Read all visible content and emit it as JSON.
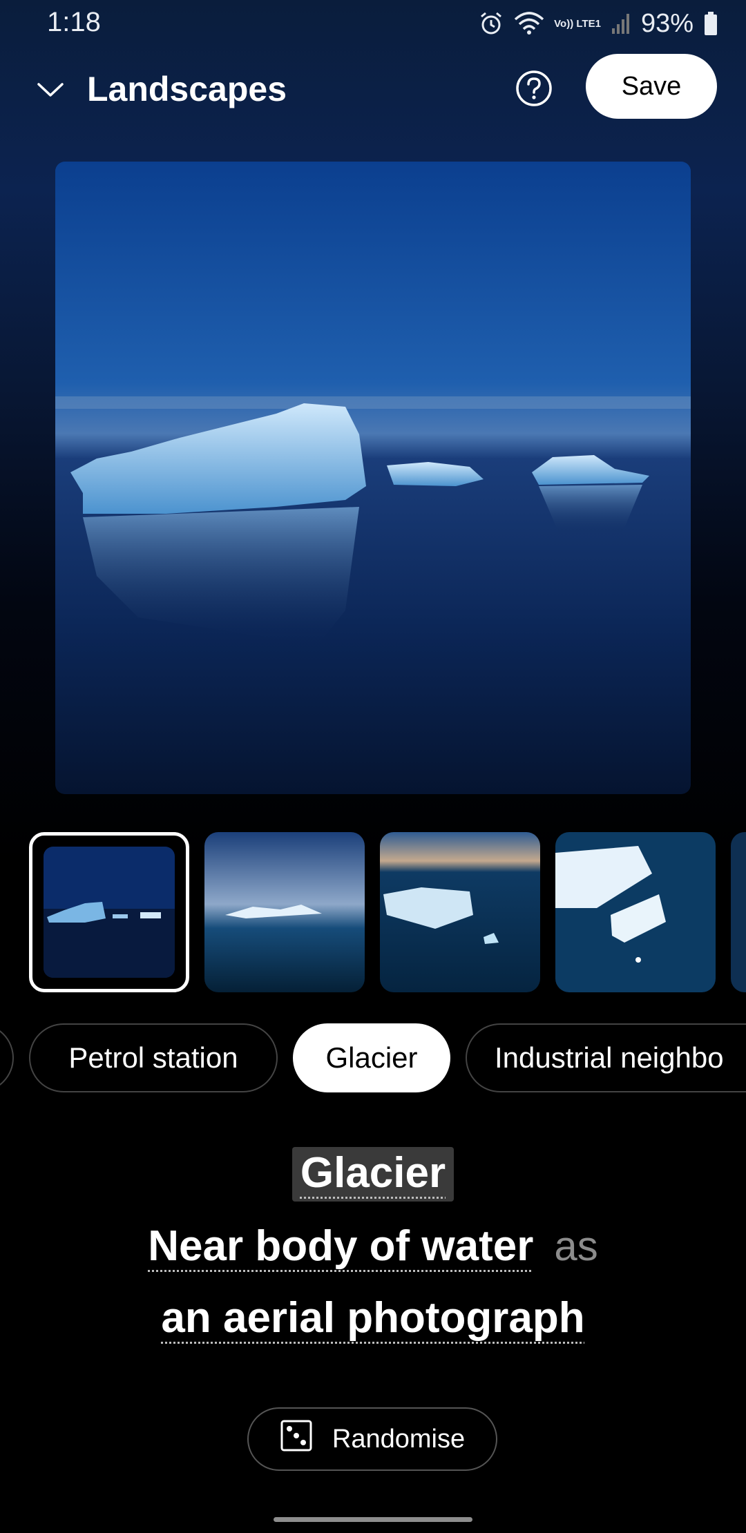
{
  "status_bar": {
    "time": "1:18",
    "network_label": "Vo)) LTE1",
    "battery": "93%",
    "icons": [
      "alarm-icon",
      "wifi-icon",
      "volte-icon",
      "signal-icon",
      "battery-icon"
    ]
  },
  "header": {
    "title": "Landscapes",
    "save_label": "Save",
    "icons": [
      "chevron-down-icon",
      "help-icon"
    ]
  },
  "preview": {
    "description_icon": "glacier-image"
  },
  "thumbnails": {
    "selected_index": 0,
    "count_visible": 5
  },
  "chips": {
    "items": [
      {
        "label": "Petrol station",
        "active": false
      },
      {
        "label": "Glacier",
        "active": true
      },
      {
        "label": "Industrial neighbo",
        "active": false
      }
    ]
  },
  "prompt": {
    "subject": "Glacier",
    "setting": "Near body of water",
    "connector": "as",
    "style": "an aerial photograph"
  },
  "randomise": {
    "label": "Randomise",
    "icon": "dice-icon"
  },
  "colors": {
    "background": "#000000",
    "accent": "#ffffff",
    "chip_border": "#444444"
  }
}
